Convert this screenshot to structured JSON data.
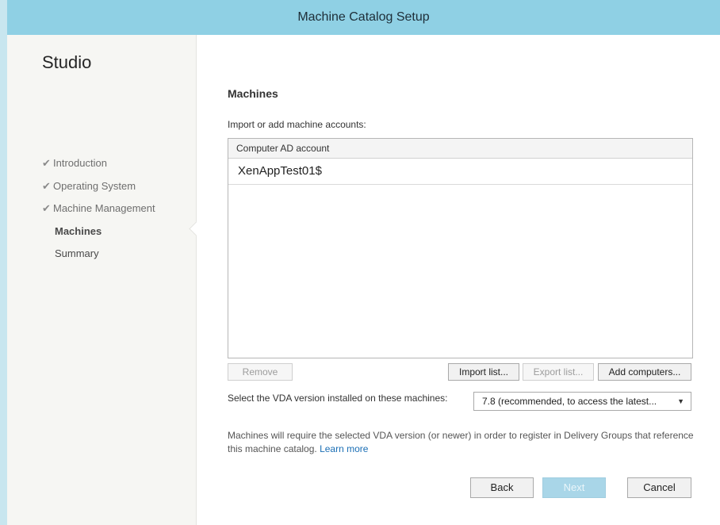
{
  "window": {
    "title": "Machine Catalog Setup"
  },
  "sidebar": {
    "brand": "Studio",
    "steps": [
      {
        "label": "Introduction",
        "done": true
      },
      {
        "label": "Operating System",
        "done": true
      },
      {
        "label": "Machine Management",
        "done": true
      },
      {
        "label": "Machines",
        "current": true
      },
      {
        "label": "Summary"
      }
    ],
    "check_glyph": "✔"
  },
  "main": {
    "heading": "Machines",
    "prompt": "Import or add machine accounts:",
    "table": {
      "column": "Computer AD account",
      "rows": [
        "XenAppTest01$"
      ]
    },
    "buttons": {
      "remove": "Remove",
      "import": "Import list...",
      "export": "Export list...",
      "add": "Add computers..."
    },
    "vda": {
      "label": "Select the VDA version installed on these machines:",
      "selected": "7.8 (recommended, to access the latest...",
      "arrow": "▼"
    },
    "note": {
      "text": "Machines will require the selected VDA version (or newer) in order to register in Delivery Groups that reference this machine catalog.",
      "link": "Learn more"
    }
  },
  "footer": {
    "back": "Back",
    "next": "Next",
    "cancel": "Cancel"
  }
}
